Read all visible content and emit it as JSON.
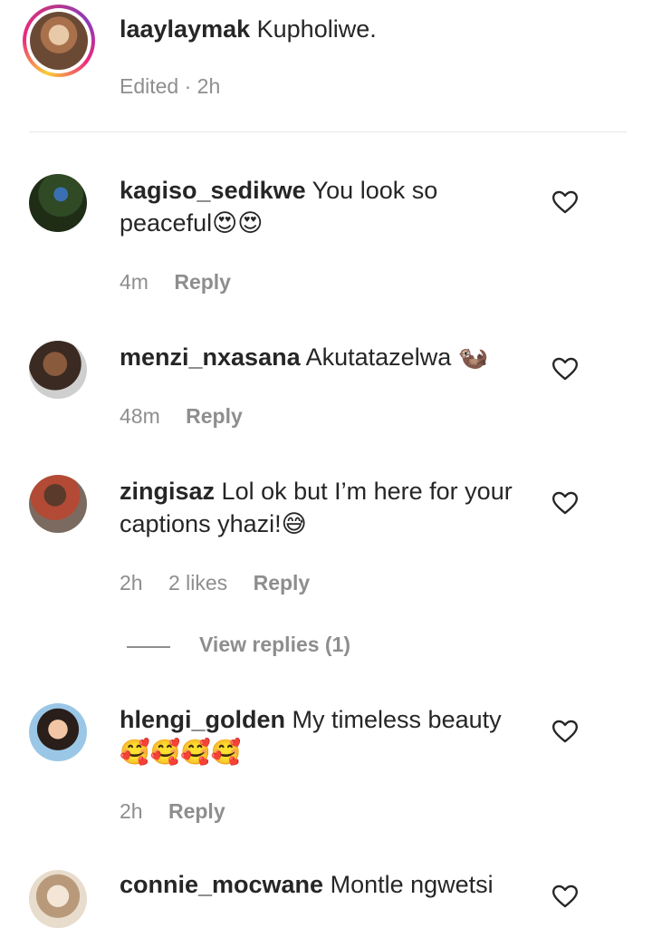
{
  "caption": {
    "username": "laaylaymak",
    "text": "Kupholiwe.",
    "meta": "Edited · 2h"
  },
  "comments": [
    {
      "username": "kagiso_sedikwe",
      "text": "You look so peaceful😍😍",
      "time": "4m",
      "likes": "",
      "reply": "Reply"
    },
    {
      "username": "menzi_nxasana",
      "text": "Akutatazelwa 🦦",
      "time": "48m",
      "likes": "",
      "reply": "Reply"
    },
    {
      "username": "zingisaz",
      "text": "Lol ok but I’m here for your captions yhazi!😅",
      "time": "2h",
      "likes": "2 likes",
      "reply": "Reply"
    },
    {
      "username": "hlengi_golden",
      "text": "My timeless beauty 🥰🥰🥰🥰",
      "time": "2h",
      "likes": "",
      "reply": "Reply"
    },
    {
      "username": "connie_mocwane",
      "text": "Montle ngwetsi",
      "time": "",
      "likes": "",
      "reply": ""
    }
  ],
  "view_replies": "View replies (1)",
  "icons": {
    "like": "heart-outline-icon"
  },
  "colors": {
    "text": "#262626",
    "secondary": "#8e8e8e",
    "divider": "#e6e6e6"
  }
}
